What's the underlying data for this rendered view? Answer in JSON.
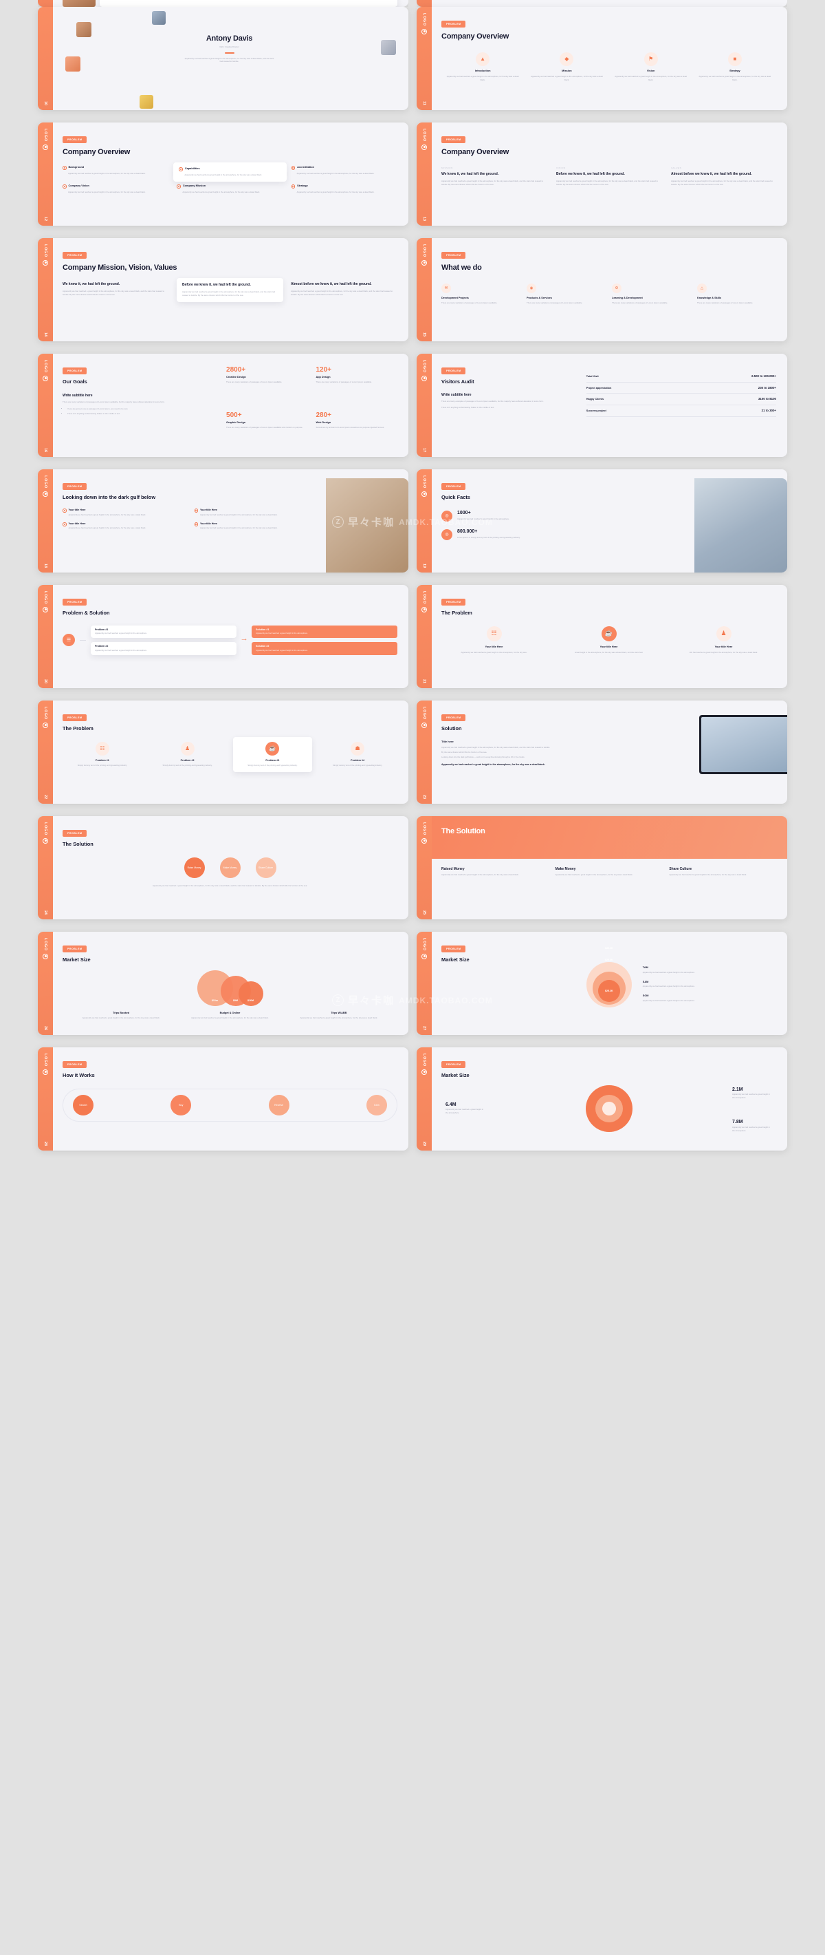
{
  "meta": {
    "watermark_badge": "Z",
    "watermark_cn": "早々卡咖",
    "watermark_en": "AMDK.TAOBAO.COM",
    "rail_logo": "LOGO",
    "brand_accent": "#f4794f",
    "brand_accent_light": "#fdece5",
    "slide_bg": "#f4f4f8",
    "page_bg": "#e2e2e2",
    "heading_color": "#16182f",
    "body_color": "#9a9cae"
  },
  "lorem": {
    "short": "Apparently we had reached a great height in the atmosphere, for the sky was a dead black.",
    "medium": "Apparently we had reached a great height in the atmosphere, for the sky was a dead black, and the stars had ceased to twinkle.",
    "long": "Apparently we had reached a great height in the atmosphere, for the sky was a dead black, and the stars had ceased to twinkle. By the same illusion which lifts the horizon of the sea.",
    "tiny": "Apparently we had reached a great height in the atmosphere, for the sky was a dead black.",
    "sky": "for the sky was a dead black."
  },
  "slides": [
    {
      "n": "10",
      "tag": "",
      "title": "Antony Davis",
      "subtitle": "CEO, Creative Director",
      "kind": "profile"
    },
    {
      "n": "11",
      "tag": "PROBLEM",
      "title": "Company Overview",
      "kind": "icon-row",
      "items": [
        {
          "label": "Introduction",
          "icon": "intro-icon",
          "glyph": "▲"
        },
        {
          "label": "Mission",
          "icon": "mission-icon",
          "glyph": "◆"
        },
        {
          "label": "Vision",
          "icon": "vision-icon",
          "glyph": "⚑"
        },
        {
          "label": "Strategy",
          "icon": "strategy-icon",
          "glyph": "■"
        }
      ]
    },
    {
      "n": "12",
      "tag": "PROBLEM",
      "title": "Company Overview",
      "kind": "bullet-grid",
      "items": [
        {
          "label": "Background",
          "highlight": false
        },
        {
          "label": "Capabilities",
          "highlight": true
        },
        {
          "label": "Accreditation",
          "highlight": false
        },
        {
          "label": "Company Vision",
          "highlight": false
        },
        {
          "label": "Company Mission",
          "highlight": false
        },
        {
          "label": "Strategy",
          "highlight": false
        }
      ]
    },
    {
      "n": "13",
      "tag": "PROBLEM",
      "title": "Company Overview",
      "kind": "three-col",
      "columns": [
        {
          "eyebrow": "Mission",
          "heading": "We knew it, we had left the ground."
        },
        {
          "eyebrow": "Vision",
          "heading": "Before we knew it, we had left the ground."
        },
        {
          "eyebrow": "Values",
          "heading": "Almost before we knew it, we had left the ground."
        }
      ]
    },
    {
      "n": "14",
      "tag": "PROBLEM",
      "title": "Company Mission, Vision, Values",
      "kind": "three-card",
      "cards": [
        {
          "heading": "We knew it, we had left the ground.",
          "raised": false
        },
        {
          "heading": "Before we knew it, we had left the ground.",
          "raised": true
        },
        {
          "heading": "Almost before we knew it, we had left the ground.",
          "raised": false
        }
      ]
    },
    {
      "n": "15",
      "tag": "PROBLEM",
      "title": "What we do",
      "kind": "icon-row-4",
      "items": [
        {
          "label": "Development Projects",
          "glyph": "⚒"
        },
        {
          "label": "Products & Services",
          "glyph": "◉"
        },
        {
          "label": "Learning & Development",
          "glyph": "⚙"
        },
        {
          "label": "Knowledge & Skills",
          "glyph": "△"
        }
      ],
      "body": "There are many variations of passages of Lorem Ipsum available."
    },
    {
      "n": "16",
      "tag": "PROBLEM",
      "title": "Our Goals",
      "kind": "goals",
      "subtitle": "Write subtitle here",
      "body": "There are many variations of passages of Lorem Ipsum available, but the majority have suffered alteration in some form.",
      "bullets": [
        "If you are going to use a passage of Lorem Ipsum, you need to be sure",
        "There isn't anything embarrassing hidden in the middle of text"
      ],
      "stats": [
        {
          "value": "2800+",
          "label": "Creative Design",
          "desc": "There are many variations of passages of Lorem Ipsum available."
        },
        {
          "value": "120+",
          "label": "App Design",
          "desc": "There are many variations of passages of Lorem Ipsum available."
        },
        {
          "value": "500+",
          "label": "Graphic Design",
          "desc": "There are many variations of passages of Lorem Ipsum available and content on purpose."
        },
        {
          "value": "280+",
          "label": "Web Design",
          "desc": "Sometimes by accident of Lorem Ipsum sometimes on purpose injected humour."
        }
      ]
    },
    {
      "n": "17",
      "tag": "PROBLEM",
      "title": "Visitors Audit",
      "kind": "audit",
      "subtitle": "Write subtitle here",
      "body": "There are many examples of passages of Lorem Ipsum available, but the majority have suffered alteration in some form.",
      "body2": "There isn't anything embarrassing hidden in the middle of text.",
      "rows": [
        {
          "label": "Total Visit",
          "value": "2.500 to 100.000+"
        },
        {
          "label": "Project appreciation",
          "value": "230 to 1800+"
        },
        {
          "label": "Happy Clients",
          "value": "3100 to 8100"
        },
        {
          "label": "Success project",
          "value": "21 to 300+"
        }
      ]
    },
    {
      "n": "18",
      "tag": "PROBLEM",
      "title": "Looking down into the dark gulf below",
      "kind": "two-by-two-photo",
      "items": [
        {
          "label": "Your title Here"
        },
        {
          "label": "Your title Here"
        },
        {
          "label": "Your title Here"
        },
        {
          "label": "Your title Here"
        }
      ]
    },
    {
      "n": "19",
      "tag": "PROBLEM",
      "title": "Quick Facts",
      "kind": "facts-photo",
      "facts": [
        {
          "value": "1000+",
          "desc": "Apparently we had reached a great height in the atmosphere."
        },
        {
          "value": "800.000+",
          "desc": "Lorem Ipsum is simply dummy text of the printing and typesetting industry."
        }
      ]
    },
    {
      "n": "20",
      "tag": "PROBLEM",
      "title": "Problem & Solution",
      "kind": "flow",
      "problems": [
        {
          "label": "Problem #1",
          "desc": "Apparently we had reached a great height in the atmosphere."
        },
        {
          "label": "Problem #2",
          "desc": "Apparently we had reached a great height in the atmosphere."
        }
      ],
      "solutions": [
        {
          "label": "Solution #1",
          "desc": "Apparently we had reached a great height in the atmosphere."
        },
        {
          "label": "Solution #2",
          "desc": "Apparently we had reached a great height in the atmosphere."
        }
      ]
    },
    {
      "n": "21",
      "tag": "PROBLEM",
      "title": "The Problem",
      "kind": "three-round",
      "items": [
        {
          "label": "Your title Here",
          "glyph": "☷",
          "desc": "Apparently we had reached a great height in the atmosphere, for the sky was."
        },
        {
          "label": "Your title Here",
          "glyph": "☕",
          "desc": "Great height in the atmosphere, for the sky was a dead black, and the stars had."
        },
        {
          "label": "Your title Here",
          "glyph": "♟",
          "desc": "We had reached a great height in the atmosphere, for the sky was a dead black."
        }
      ]
    },
    {
      "n": "22",
      "tag": "PROBLEM",
      "title": "The Problem",
      "kind": "four-round",
      "items": [
        {
          "label": "Problem #1",
          "glyph": "☷",
          "active": false
        },
        {
          "label": "Problem #2",
          "glyph": "♟",
          "active": false
        },
        {
          "label": "Problem #3",
          "glyph": "☕",
          "active": true
        },
        {
          "label": "Problem #4",
          "glyph": "☗",
          "active": false
        }
      ],
      "desc": "Simply dummy text of the printing and typesetting industry."
    },
    {
      "n": "23",
      "tag": "PROBLEM",
      "title": "Solution",
      "kind": "solution-laptop",
      "heading": "Title here",
      "bullets": [
        "Apparently we had reached a great height in the atmosphere, for the sky was a dead black, and the stars had ceased to twinkle.",
        "By the same illusion which lifts the horizon of the sea.",
        "Looking down into the dark gulf below — and not in a way like showing through a rift in the clouds."
      ],
      "footer": "Apparently we had reached a great height in the atmosphere, for the sky was a dead black."
    },
    {
      "n": "24",
      "tag": "PROBLEM",
      "title": "The Solution",
      "kind": "three-bubble",
      "items": [
        {
          "label": "Raise Money"
        },
        {
          "label": "Make Money"
        },
        {
          "label": "Share Culture"
        }
      ],
      "footer": "Apparently we had reached a great height in the atmosphere, for the sky was a dead black, and the stars had ceased to twinkle. By the same illusion which lifts the horizon of the sea."
    },
    {
      "n": "25",
      "tag": "",
      "title": "The Solution",
      "kind": "hero-solution",
      "items": [
        {
          "label": "Raised Money",
          "desc": "Apparently we had reached a great height in the atmosphere, for the sky was a dead black."
        },
        {
          "label": "Make Money",
          "desc": "Apparently we had reached a great height in the atmosphere, for the sky was a dead black."
        },
        {
          "label": "Share Culture",
          "desc": "Apparently we had reached a great height in the atmosphere, for the sky was a dead black."
        }
      ]
    },
    {
      "n": "26",
      "tag": "PROBLEM",
      "title": "Market Size",
      "kind": "market-circles",
      "chart_ref": 0
    },
    {
      "n": "27",
      "tag": "PROBLEM",
      "title": "Market Size",
      "kind": "market-donut",
      "chart_ref": 1
    },
    {
      "n": "28",
      "tag": "PROBLEM",
      "title": "How it Works",
      "kind": "steps",
      "items": [
        {
          "label": "Search"
        },
        {
          "label": "Buy"
        },
        {
          "label": "Receive"
        },
        {
          "label": "Earn"
        }
      ]
    },
    {
      "n": "29",
      "tag": "PROBLEM",
      "title": "Market Size",
      "kind": "market-radial",
      "chart_ref": 2
    }
  ],
  "chart_data": [
    {
      "type": "bubble",
      "title": "Market Size",
      "categories": [
        "Trips Booked",
        "Budget & Online",
        "Trips W/ABB"
      ],
      "values": [
        "$10m",
        "$9M",
        "$16M"
      ],
      "descriptions": [
        "Apparently we had reached a great height in the atmosphere, for the sky was a dead black.",
        "Apparently we had reached a great height in the atmosphere, for the sky was a dead black.",
        "Apparently we had reached a great height in the atmosphere, for the sky was a dead black."
      ],
      "colors": [
        "#f8a886",
        "#f8855f",
        "#f4794f"
      ]
    },
    {
      "type": "donut",
      "title": "Market Size",
      "categories": [
        "TAM",
        "SAM",
        "SOM"
      ],
      "labels": [
        "$35.6K",
        "$29.6K",
        "$25.2K"
      ],
      "legend": [
        {
          "name": "TAM",
          "desc": "Apparently we had reached a great height in the atmosphere."
        },
        {
          "name": "SAM",
          "desc": "Apparently we had reached a great height in the atmosphere."
        },
        {
          "name": "SOM",
          "desc": "Apparently we had reached a great height in the atmosphere."
        }
      ],
      "colors": [
        "#fcd9c9",
        "#f8a886",
        "#f4794f"
      ]
    },
    {
      "type": "radial",
      "title": "Market Size",
      "callouts": [
        {
          "value": "2.1M",
          "desc": "Apparently we had reached a great height in the atmosphere."
        },
        {
          "value": "7.8M",
          "desc": "Apparently we had reached a great height in the atmosphere."
        },
        {
          "value": "6.4M",
          "desc": "Apparently we had reached a great height in the atmosphere."
        }
      ],
      "colors": [
        "#f4794f",
        "#f8a886",
        "#fdece5"
      ]
    }
  ]
}
